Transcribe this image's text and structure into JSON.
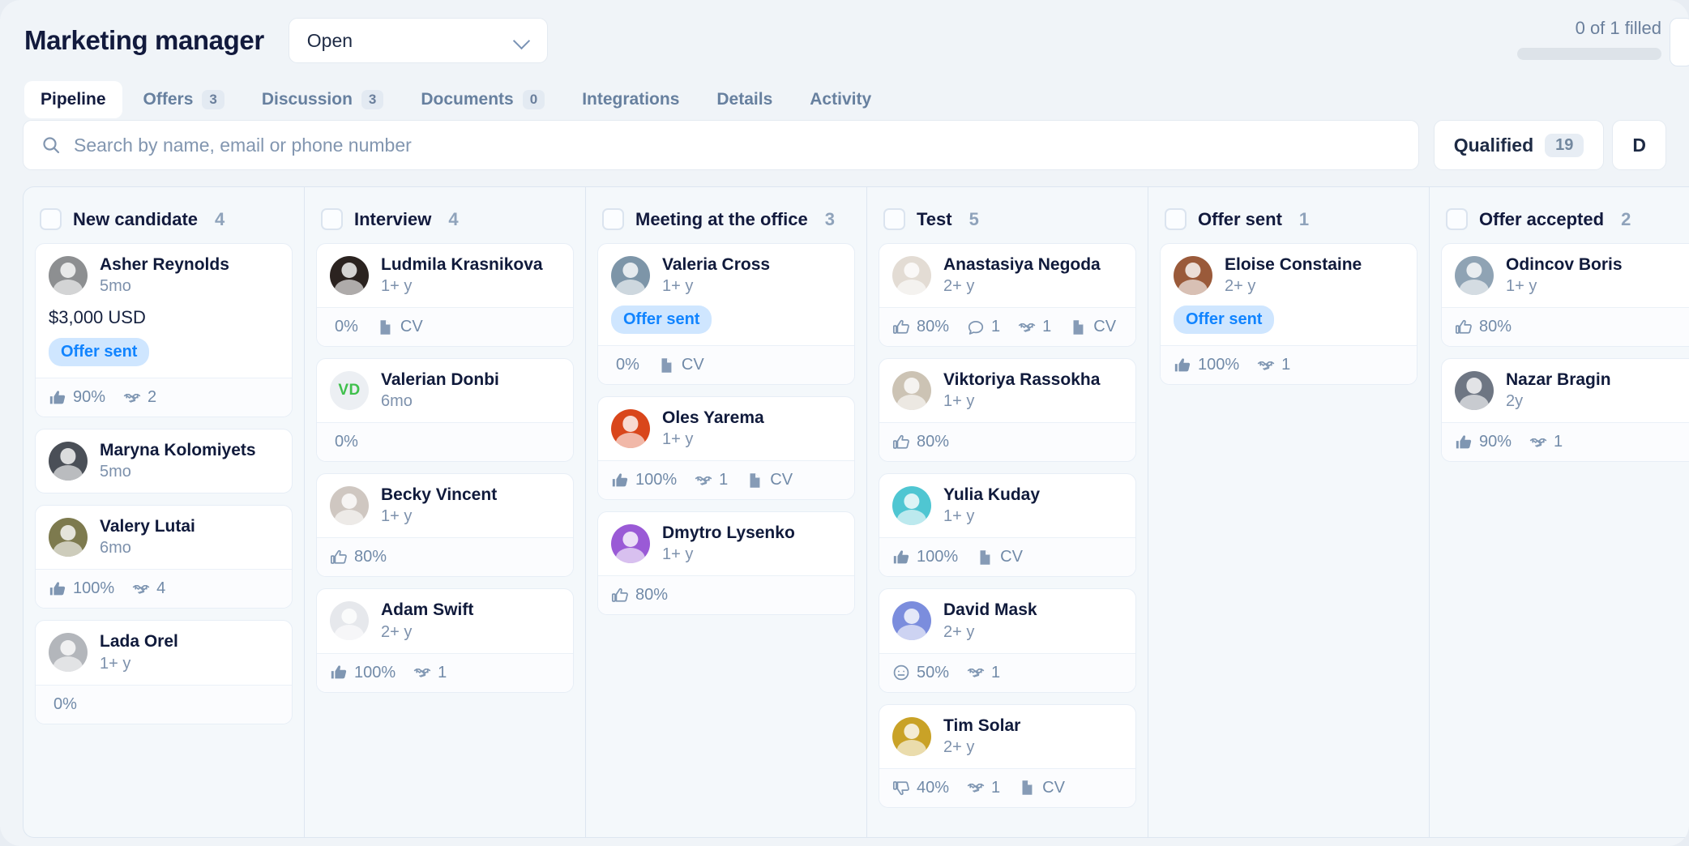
{
  "header": {
    "title": "Marketing manager",
    "status_value": "Open",
    "status_icon": "chevron-down-icon",
    "filled_text": "0 of 1 filled",
    "tabs": [
      {
        "label": "Pipeline",
        "count": null,
        "active": true
      },
      {
        "label": "Offers",
        "count": "3",
        "active": false
      },
      {
        "label": "Discussion",
        "count": "3",
        "active": false
      },
      {
        "label": "Documents",
        "count": "0",
        "active": false
      },
      {
        "label": "Integrations",
        "count": null,
        "active": false
      },
      {
        "label": "Details",
        "count": null,
        "active": false
      },
      {
        "label": "Activity",
        "count": null,
        "active": false
      }
    ]
  },
  "search": {
    "placeholder": "Search by name, email or phone number",
    "value": "",
    "icon": "search-icon"
  },
  "filters": [
    {
      "label": "Qualified",
      "count": "19"
    },
    {
      "label": "D",
      "count": ""
    }
  ],
  "columns": [
    {
      "title": "New candidate",
      "count": "4",
      "cards": [
        {
          "name": "Asher Reynolds",
          "experience": "5mo",
          "salary": "$3,000 USD",
          "badge": "Offer sent",
          "avatar_color": "#8d8f91",
          "metrics": [
            {
              "icon": "thumbs-up-filled-icon",
              "value": "90%"
            },
            {
              "icon": "handshake-icon",
              "value": "2"
            }
          ]
        },
        {
          "name": "Maryna Kolomiyets",
          "experience": "5mo",
          "salary": "",
          "badge": "",
          "avatar_color": "#4a4f57",
          "metrics": []
        },
        {
          "name": "Valery Lutai",
          "experience": "6mo",
          "salary": "",
          "badge": "",
          "avatar_color": "#7d7a4e",
          "metrics": [
            {
              "icon": "thumbs-up-filled-icon",
              "value": "100%"
            },
            {
              "icon": "handshake-icon",
              "value": "4"
            }
          ]
        },
        {
          "name": "Lada Orel",
          "experience": "1+ y",
          "salary": "",
          "badge": "",
          "avatar_color": "#b3b6bb",
          "metrics": [
            {
              "icon": "none",
              "value": "0%"
            }
          ]
        }
      ]
    },
    {
      "title": "Interview",
      "count": "4",
      "cards": [
        {
          "name": "Ludmila Krasnikova",
          "experience": "1+ y",
          "salary": "",
          "badge": "",
          "avatar_color": "#2b2320",
          "metrics": [
            {
              "icon": "none",
              "value": "0%"
            },
            {
              "icon": "cv-icon",
              "value": "CV"
            }
          ]
        },
        {
          "name": "Valerian Donbi",
          "experience": "6mo",
          "salary": "",
          "badge": "",
          "avatar_initials": "VD",
          "avatar_color": "#eceff3",
          "metrics": [
            {
              "icon": "none",
              "value": "0%"
            }
          ]
        },
        {
          "name": "Becky Vincent",
          "experience": "1+ y",
          "salary": "",
          "badge": "",
          "avatar_color": "#cfc7c1",
          "metrics": [
            {
              "icon": "thumbs-up-outline-icon",
              "value": "80%"
            }
          ]
        },
        {
          "name": "Adam Swift",
          "experience": "2+ y",
          "salary": "",
          "badge": "",
          "avatar_color": "#e6e8ec",
          "metrics": [
            {
              "icon": "thumbs-up-filled-icon",
              "value": "100%"
            },
            {
              "icon": "handshake-icon",
              "value": "1"
            }
          ]
        }
      ]
    },
    {
      "title": "Meeting at the office",
      "count": "3",
      "cards": [
        {
          "name": "Valeria Cross",
          "experience": "1+ y",
          "salary": "",
          "badge": "Offer sent",
          "avatar_color": "#7d95a8",
          "metrics": [
            {
              "icon": "none",
              "value": "0%"
            },
            {
              "icon": "cv-icon",
              "value": "CV"
            }
          ]
        },
        {
          "name": "Oles Yarema",
          "experience": "1+ y",
          "salary": "",
          "badge": "",
          "avatar_color": "#d9461b",
          "metrics": [
            {
              "icon": "thumbs-up-filled-icon",
              "value": "100%"
            },
            {
              "icon": "handshake-icon",
              "value": "1"
            },
            {
              "icon": "cv-icon",
              "value": "CV"
            }
          ]
        },
        {
          "name": "Dmytro Lysenko",
          "experience": "1+ y",
          "salary": "",
          "badge": "",
          "avatar_color": "#9a5ad6",
          "metrics": [
            {
              "icon": "thumbs-up-outline-icon",
              "value": "80%"
            }
          ]
        }
      ]
    },
    {
      "title": "Test",
      "count": "5",
      "cards": [
        {
          "name": "Anastasiya Negoda",
          "experience": "2+ y",
          "salary": "",
          "badge": "",
          "avatar_color": "#e3dcd4",
          "metrics": [
            {
              "icon": "thumbs-up-outline-icon",
              "value": "80%"
            },
            {
              "icon": "comment-icon",
              "value": "1"
            },
            {
              "icon": "handshake-icon",
              "value": "1"
            },
            {
              "icon": "cv-icon",
              "value": "CV"
            }
          ]
        },
        {
          "name": "Viktoriya Rassokha",
          "experience": "1+ y",
          "salary": "",
          "badge": "",
          "avatar_color": "#ccc3b4",
          "metrics": [
            {
              "icon": "thumbs-up-outline-icon",
              "value": "80%"
            }
          ]
        },
        {
          "name": "Yulia Kuday",
          "experience": "1+ y",
          "salary": "",
          "badge": "",
          "avatar_color": "#4fc6d2",
          "metrics": [
            {
              "icon": "thumbs-up-filled-icon",
              "value": "100%"
            },
            {
              "icon": "cv-icon",
              "value": "CV"
            }
          ]
        },
        {
          "name": "David Mask",
          "experience": "2+ y",
          "salary": "",
          "badge": "",
          "avatar_color": "#7b8ddd",
          "metrics": [
            {
              "icon": "neutral-face-icon",
              "value": "50%"
            },
            {
              "icon": "handshake-icon",
              "value": "1"
            }
          ]
        },
        {
          "name": "Tim Solar",
          "experience": "2+ y",
          "salary": "",
          "badge": "",
          "avatar_color": "#c9a227",
          "metrics": [
            {
              "icon": "thumbs-down-icon",
              "value": "40%"
            },
            {
              "icon": "handshake-icon",
              "value": "1"
            },
            {
              "icon": "cv-icon",
              "value": "CV"
            }
          ]
        }
      ]
    },
    {
      "title": "Offer sent",
      "count": "1",
      "cards": [
        {
          "name": "Eloise Constaine",
          "experience": "2+ y",
          "salary": "",
          "badge": "Offer sent",
          "avatar_color": "#9a5a3a",
          "metrics": [
            {
              "icon": "thumbs-up-filled-icon",
              "value": "100%"
            },
            {
              "icon": "handshake-icon",
              "value": "1"
            }
          ]
        }
      ]
    },
    {
      "title": "Offer accepted",
      "count": "2",
      "cards": [
        {
          "name": "Odincov Boris",
          "experience": "1+ y",
          "salary": "",
          "badge": "",
          "avatar_color": "#8fa3b4",
          "metrics": [
            {
              "icon": "thumbs-up-outline-icon",
              "value": "80%"
            }
          ]
        },
        {
          "name": "Nazar Bragin",
          "experience": "2y",
          "salary": "",
          "badge": "",
          "avatar_color": "#6e7683",
          "metrics": [
            {
              "icon": "thumbs-up-filled-icon",
              "value": "90%"
            },
            {
              "icon": "handshake-icon",
              "value": "1"
            }
          ]
        }
      ]
    }
  ],
  "colors": {
    "accent": "#1184ff",
    "badge_bg": "#cfe6ff",
    "title": "#121a3d",
    "muted": "#7d91ac",
    "page_bg": "#f0f4f8"
  }
}
